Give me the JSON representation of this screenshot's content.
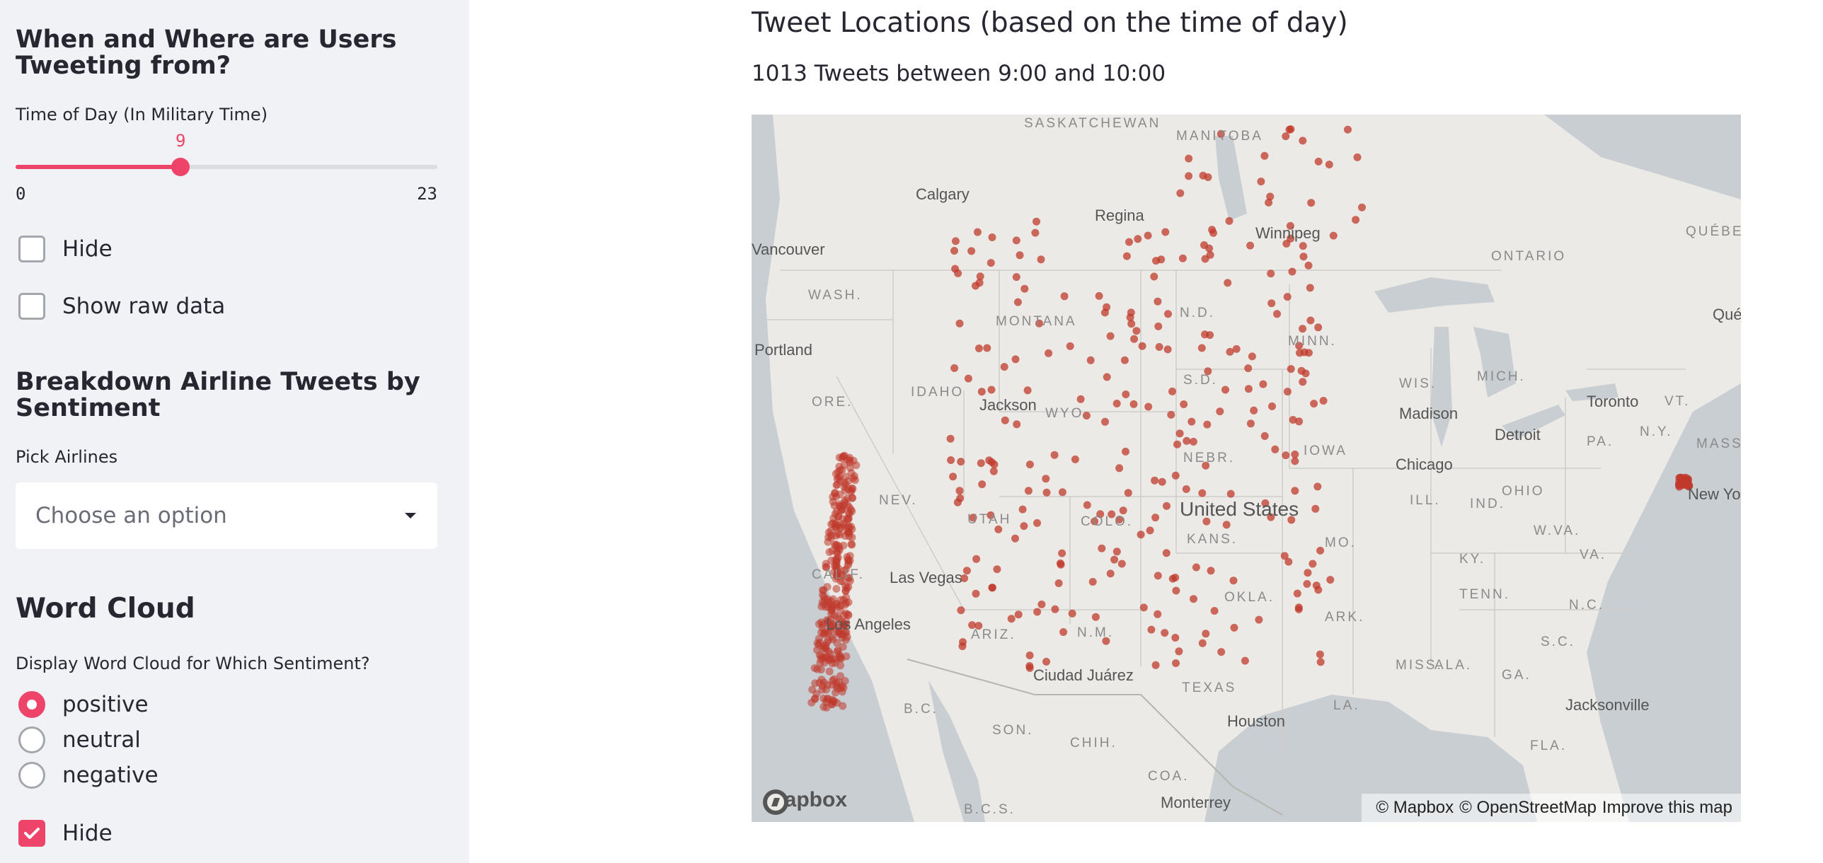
{
  "sidebar": {
    "section1_title_line1": "When and Where are Users",
    "section1_title_line2": "Tweeting from?",
    "slider_label": "Time of Day (In Military Time)",
    "slider_value": "9",
    "slider_min": "0",
    "slider_max": "23",
    "slider_fraction": 0.3913,
    "hide_checkbox_1": "Hide",
    "show_raw_checkbox": "Show raw data",
    "section2_title_line1": "Breakdown Airline Tweets by",
    "section2_title_line2": "Sentiment",
    "pick_airlines_label": "Pick Airlines",
    "select_placeholder": "Choose an option",
    "section3_title": "Word Cloud",
    "wordcloud_label": "Display Word Cloud for Which Sentiment?",
    "radio_options": [
      "positive",
      "neutral",
      "negative"
    ],
    "radio_selected": "positive",
    "hide_checkbox_2": "Hide",
    "hide_checkbox_2_checked": true
  },
  "main": {
    "title": "Tweet Locations (based on the time of day)",
    "subtitle": "1013 Tweets between 9:00 and 10:00"
  },
  "map": {
    "logo_text": "mapbox",
    "attribution_1": "© Mapbox",
    "attribution_2": "© OpenStreetMap",
    "attribution_3": "Improve this map",
    "regions": [
      "SASKATCHEWAN",
      "MANITOBA",
      "ONTARIO",
      "QUÉBEC",
      "WASH.",
      "MONTANA",
      "N.D.",
      "MINN.",
      "WIS.",
      "MICH.",
      "ORE.",
      "IDAHO",
      "WYO.",
      "S.D.",
      "IOWA",
      "NEV.",
      "UTAH",
      "COLO.",
      "NEBR.",
      "ILL.",
      "IND.",
      "OHIO",
      "PA.",
      "N.Y.",
      "MASS.",
      "VT.",
      "CALIF.",
      "ARIZ.",
      "N.M.",
      "OKLA.",
      "KANS.",
      "MO.",
      "KY.",
      "W.VA.",
      "VA.",
      "ARK.",
      "TENN.",
      "N.C.",
      "S.C.",
      "MISS.",
      "ALA.",
      "GA.",
      "LA.",
      "TEXAS",
      "FLA.",
      "SON.",
      "CHIH.",
      "COA.",
      "B.C.",
      "B.C.S."
    ],
    "cities": [
      "Calgary",
      "Regina",
      "Winnipeg",
      "Vancouver",
      "Portland",
      "Jackson",
      "Madison",
      "Toronto",
      "Detroit",
      "Chicago",
      "Las Vegas",
      "Los Angeles",
      "Ciudad Juárez",
      "Houston",
      "Jacksonville",
      "Monterrey",
      "New York",
      "Québec"
    ],
    "country": "United States",
    "colors": {
      "point": "#c0392b",
      "water": "#c8ced2",
      "land": "#eceae7",
      "accent": "#ef4469"
    }
  }
}
